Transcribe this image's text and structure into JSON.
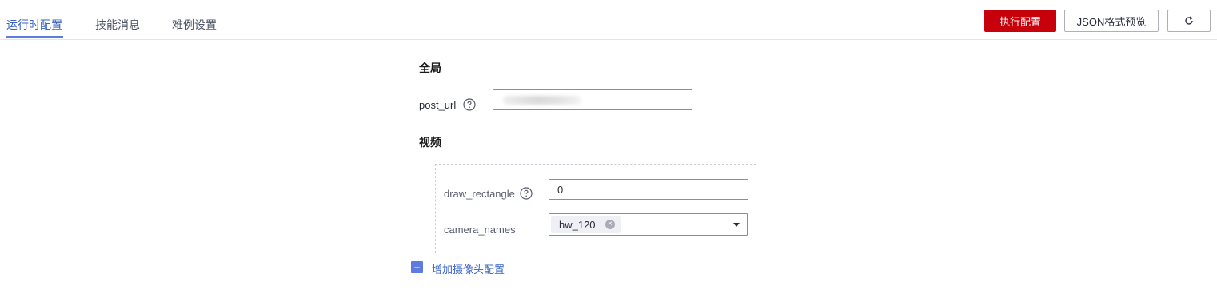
{
  "tabs": [
    {
      "label": "运行时配置",
      "active": true
    },
    {
      "label": "技能消息",
      "active": false
    },
    {
      "label": "难例设置",
      "active": false
    }
  ],
  "toolbar": {
    "execute_label": "执行配置",
    "json_preview_label": "JSON格式预览",
    "refresh_icon": "refresh-icon"
  },
  "global": {
    "title": "全局",
    "post_url": {
      "label": "post_url",
      "value": ""
    }
  },
  "video": {
    "title": "视频",
    "draw_rectangle": {
      "label": "draw_rectangle",
      "value": "0"
    },
    "camera_names": {
      "label": "camera_names",
      "tags": [
        "hw_120"
      ]
    },
    "add_camera_label": "增加摄像头配置"
  },
  "colors": {
    "primary": "#c7000b",
    "accent": "#5e7ce0",
    "link": "#3a62c4"
  }
}
